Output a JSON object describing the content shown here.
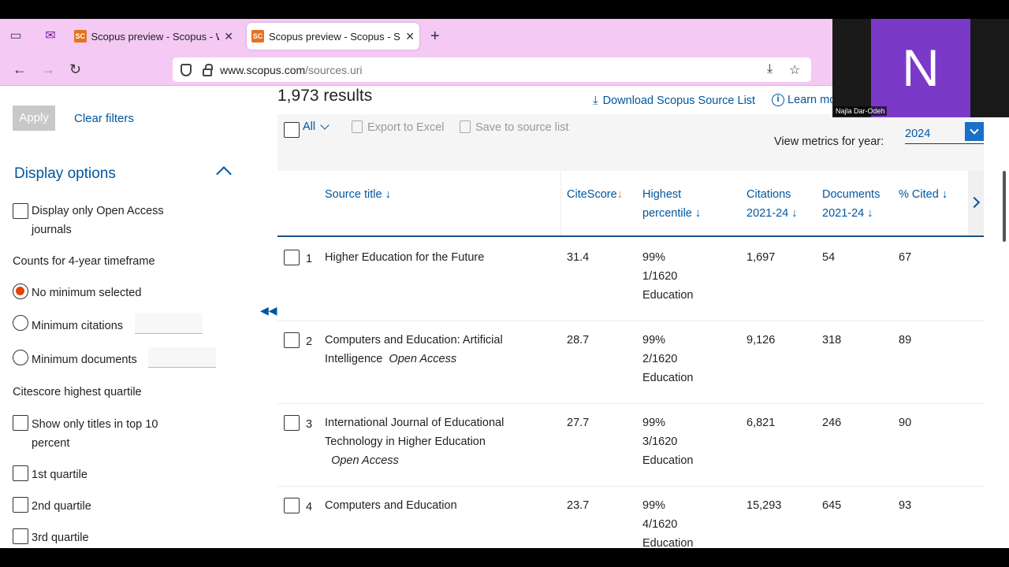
{
  "browser": {
    "tabs": [
      {
        "favicon": "SC",
        "title": "Scopus preview - Scopus - Welc",
        "active": false
      },
      {
        "favicon": "SC",
        "title": "Scopus preview - Scopus - Sour",
        "active": true
      }
    ],
    "new_tab": "+",
    "url_host": "www.scopus.com",
    "url_path": "/sources.uri"
  },
  "video": {
    "initial": "N",
    "participant": "Najla Dar-Odeh",
    "color": "#7b39c8"
  },
  "sidebar": {
    "apply": "Apply",
    "clear_filters": "Clear filters",
    "display_options": "Display options",
    "open_access_line1": "Display only Open Access",
    "open_access_line2": "journals",
    "counts_heading": "Counts for 4-year timeframe",
    "no_minimum": "No minimum selected",
    "min_citations": "Minimum citations",
    "min_documents": "Minimum documents",
    "quartile_heading": "Citescore highest quartile",
    "top10_line1": "Show only titles in top 10",
    "top10_line2": "percent",
    "q1": "1st quartile",
    "q2": "2nd quartile",
    "q3": "3rd quartile"
  },
  "main": {
    "results": "1,973 results",
    "download": "Download Scopus Source List",
    "learn": "Learn mo",
    "all": "All",
    "export": "Export to Excel",
    "save": "Save to source list",
    "view_metrics": "View metrics for year:",
    "year": "2024"
  },
  "table": {
    "headers": {
      "source_title": "Source title",
      "citescore": "CiteScore",
      "highest_1": "Highest",
      "highest_2": "percentile",
      "citations_1": "Citations",
      "citations_2": "2021-24",
      "documents_1": "Documents",
      "documents_2": "2021-24",
      "cited": "% Cited"
    },
    "rows": [
      {
        "n": "1",
        "title1": "Higher Education for the Future",
        "title2": "",
        "oa": "",
        "citescore": "31.4",
        "pct": "99%",
        "rank": "1/1620",
        "field": "Education",
        "citations": "1,697",
        "documents": "54",
        "cited": "67"
      },
      {
        "n": "2",
        "title1": "Computers and Education: Artificial",
        "title2": "Intelligence",
        "oa": "Open Access",
        "citescore": "28.7",
        "pct": "99%",
        "rank": "2/1620",
        "field": "Education",
        "citations": "9,126",
        "documents": "318",
        "cited": "89"
      },
      {
        "n": "3",
        "title1": "International Journal of Educational",
        "title2": "Technology in Higher Education",
        "oa": "Open Access",
        "citescore": "27.7",
        "pct": "99%",
        "rank": "3/1620",
        "field": "Education",
        "citations": "6,821",
        "documents": "246",
        "cited": "90"
      },
      {
        "n": "4",
        "title1": "Computers and Education",
        "title2": "",
        "oa": "",
        "citescore": "23.7",
        "pct": "99%",
        "rank": "4/1620",
        "field": "Education",
        "citations": "15,293",
        "documents": "645",
        "cited": "93"
      }
    ]
  }
}
